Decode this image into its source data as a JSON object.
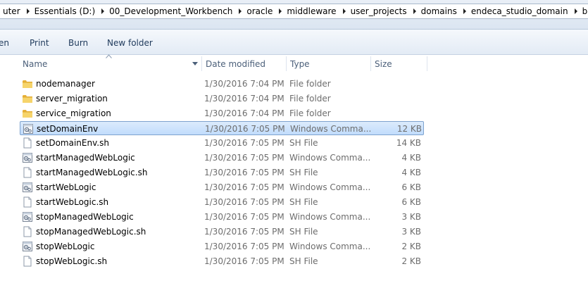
{
  "breadcrumb": [
    "uter",
    "Essentials (D:)",
    "00_Development_Workbench",
    "oracle",
    "middleware",
    "user_projects",
    "domains",
    "endeca_studio_domain",
    "bin"
  ],
  "toolbar": {
    "open_label": "en",
    "print_label": "Print",
    "burn_label": "Burn",
    "new_folder_label": "New folder"
  },
  "columns": {
    "name": "Name",
    "date": "Date modified",
    "type": "Type",
    "size": "Size"
  },
  "files": [
    {
      "name": "nodemanager",
      "date": "1/30/2016 7:04 PM",
      "type": "File folder",
      "size": "",
      "icon": "folder-icon"
    },
    {
      "name": "server_migration",
      "date": "1/30/2016 7:04 PM",
      "type": "File folder",
      "size": "",
      "icon": "folder-icon"
    },
    {
      "name": "service_migration",
      "date": "1/30/2016 7:04 PM",
      "type": "File folder",
      "size": "",
      "icon": "folder-icon"
    },
    {
      "name": "setDomainEnv",
      "date": "1/30/2016 7:05 PM",
      "type": "Windows Comma...",
      "size": "12 KB",
      "icon": "batch-file-icon"
    },
    {
      "name": "setDomainEnv.sh",
      "date": "1/30/2016 7:05 PM",
      "type": "SH File",
      "size": "14 KB",
      "icon": "blank-file-icon"
    },
    {
      "name": "startManagedWebLogic",
      "date": "1/30/2016 7:05 PM",
      "type": "Windows Comma...",
      "size": "4 KB",
      "icon": "batch-file-icon"
    },
    {
      "name": "startManagedWebLogic.sh",
      "date": "1/30/2016 7:05 PM",
      "type": "SH File",
      "size": "4 KB",
      "icon": "blank-file-icon"
    },
    {
      "name": "startWebLogic",
      "date": "1/30/2016 7:05 PM",
      "type": "Windows Comma...",
      "size": "6 KB",
      "icon": "batch-file-icon"
    },
    {
      "name": "startWebLogic.sh",
      "date": "1/30/2016 7:05 PM",
      "type": "SH File",
      "size": "6 KB",
      "icon": "blank-file-icon"
    },
    {
      "name": "stopManagedWebLogic",
      "date": "1/30/2016 7:05 PM",
      "type": "Windows Comma...",
      "size": "3 KB",
      "icon": "batch-file-icon"
    },
    {
      "name": "stopManagedWebLogic.sh",
      "date": "1/30/2016 7:05 PM",
      "type": "SH File",
      "size": "3 KB",
      "icon": "blank-file-icon"
    },
    {
      "name": "stopWebLogic",
      "date": "1/30/2016 7:05 PM",
      "type": "Windows Comma...",
      "size": "2 KB",
      "icon": "batch-file-icon"
    },
    {
      "name": "stopWebLogic.sh",
      "date": "1/30/2016 7:05 PM",
      "type": "SH File",
      "size": "2 KB",
      "icon": "blank-file-icon"
    }
  ],
  "selected_file": "setDomainEnv",
  "colors": {
    "selection_fill": "#c1dcfc",
    "selection_border": "#7da2ce",
    "folder_yellow": "#f2c94c",
    "toolbar_text": "#1e395b"
  }
}
